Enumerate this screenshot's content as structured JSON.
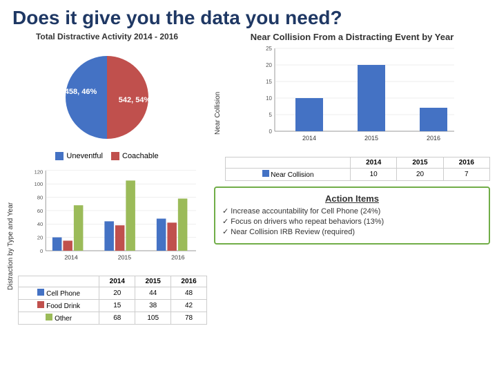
{
  "title": "Does it give you the data you need?",
  "pie": {
    "title": "Total Distractive Activity 2014 - 2016",
    "slices": [
      {
        "label": "458, 46%",
        "value": 46,
        "color": "#c0504d"
      },
      {
        "label": "542, 54%",
        "value": 54,
        "color": "#4472c4"
      }
    ],
    "legend": [
      {
        "label": "Uneventful",
        "color": "#4472c4"
      },
      {
        "label": "Coachable",
        "color": "#c0504d"
      }
    ]
  },
  "bar_chart": {
    "y_axis_label": "Distraction by Type and Year",
    "y_max": 120,
    "y_ticks": [
      0,
      20,
      40,
      60,
      80,
      100,
      120
    ],
    "x_labels": [
      "2014",
      "2015",
      "2016"
    ],
    "series": [
      {
        "name": "Cell Phone",
        "color": "#4472c4",
        "values": [
          20,
          44,
          48
        ]
      },
      {
        "name": "Food Drink",
        "color": "#c0504d",
        "values": [
          15,
          38,
          42
        ]
      },
      {
        "name": "Other",
        "color": "#9bbb59",
        "values": [
          68,
          105,
          78
        ]
      }
    ],
    "table_headers": [
      "",
      "2014",
      "2015",
      "2016"
    ],
    "table_rows": [
      {
        "label": "Cell Phone",
        "color": "#4472c4",
        "values": [
          "20",
          "44",
          "48"
        ]
      },
      {
        "label": "Food Drink",
        "color": "#c0504d",
        "values": [
          "15",
          "38",
          "42"
        ]
      },
      {
        "label": "Other",
        "color": "#9bbb59",
        "values": [
          "68",
          "105",
          "78"
        ]
      }
    ]
  },
  "near_collision": {
    "title": "Near Collision From a Distracting Event by Year",
    "y_axis_label": "Near Collision",
    "y_max": 25,
    "y_ticks": [
      0,
      5,
      10,
      15,
      20,
      25
    ],
    "x_labels": [
      "2014",
      "2015",
      "2016"
    ],
    "series": [
      {
        "name": "Near Collision",
        "color": "#4472c4",
        "values": [
          10,
          20,
          7
        ]
      }
    ],
    "table_headers": [
      "",
      "2014",
      "2015",
      "2016"
    ],
    "table_rows": [
      {
        "label": "Near Collision",
        "color": "#4472c4",
        "values": [
          "10",
          "20",
          "7"
        ]
      }
    ]
  },
  "action_items": {
    "title": "Action Items",
    "items": [
      "Increase accountability for Cell Phone (24%)",
      "Focus on drivers who repeat behaviors (13%)",
      "Near Collision IRB Review (required)"
    ]
  }
}
